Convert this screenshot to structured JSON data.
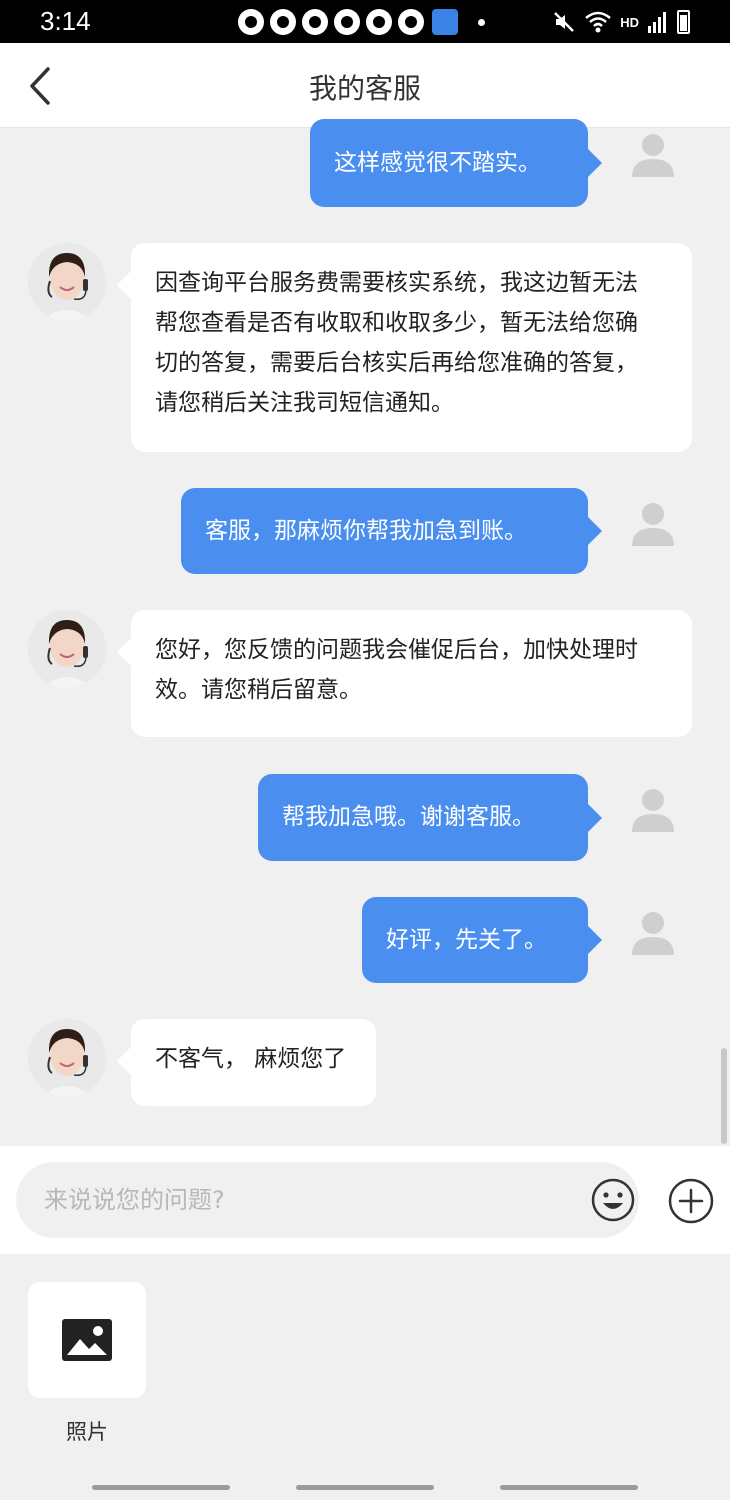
{
  "status_bar": {
    "time": "3:14",
    "network_label": "HD"
  },
  "header": {
    "title": "我的客服"
  },
  "messages": [
    {
      "from": "user",
      "text": "这样感觉很不踏实。"
    },
    {
      "from": "agent",
      "lines": [
        "因查询平台服务费需要核实系统，我这边暂无法",
        "帮您查看是否有收取和收取多少，暂无法给您确",
        "切的答复，需要后台核实后再给您准确的答复，",
        "请您稍后关注我司短信通知。"
      ]
    },
    {
      "from": "user",
      "text": "客服，那麻烦你帮我加急到账。"
    },
    {
      "from": "agent",
      "lines": [
        "您好，您反馈的问题我会催促后台，加快处理时",
        "效。请您稍后留意。"
      ]
    },
    {
      "from": "user",
      "text": "帮我加急哦。谢谢客服。"
    },
    {
      "from": "user",
      "text": "好评，先关了。"
    },
    {
      "from": "agent",
      "lines": [
        "不客气， 麻烦您了"
      ]
    }
  ],
  "composer": {
    "placeholder": "来说说您的问题?",
    "value": ""
  },
  "extension_panel": {
    "items": [
      {
        "label": "照片",
        "icon": "image-icon"
      }
    ]
  },
  "icons": {
    "back": "chevron-left-icon",
    "user_avatar": "default-user-avatar-icon",
    "emoji": "smiley-icon",
    "more": "plus-circle-icon"
  },
  "colors": {
    "user_bubble": "#4a8ff0",
    "agent_bubble": "#ffffff",
    "background": "#f0f0f0"
  }
}
